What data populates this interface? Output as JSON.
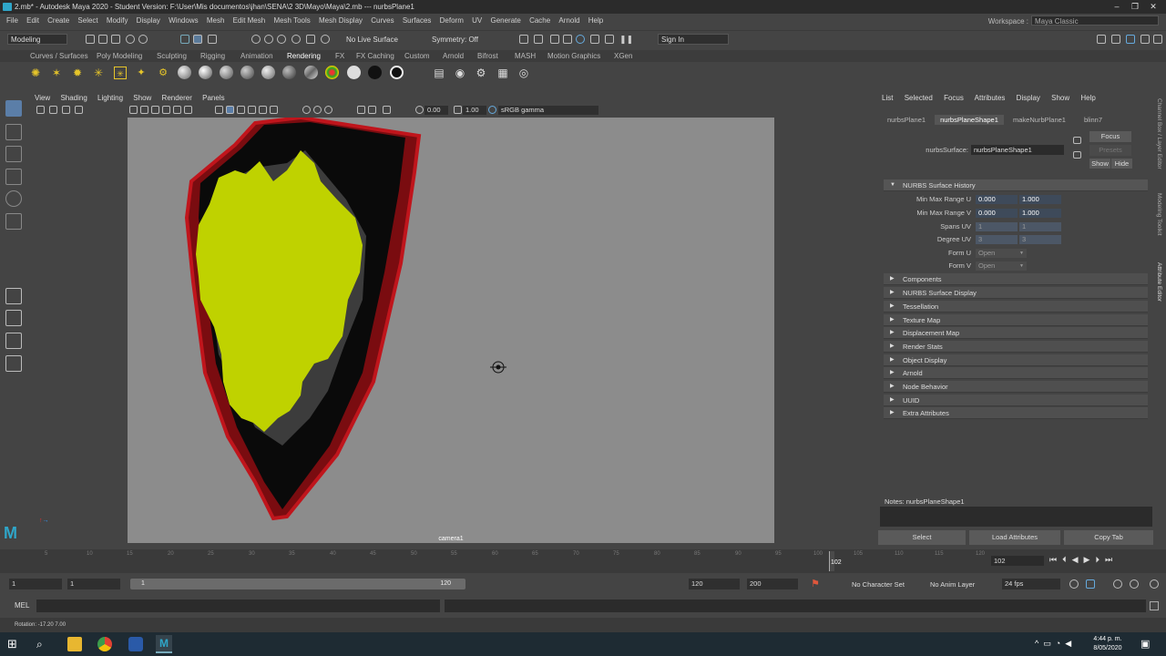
{
  "window": {
    "title": "2.mb* - Autodesk Maya 2020 - Student Version: F:\\User\\Mis documentos\\jhan\\SENA\\2 3D\\Mayo\\Maya\\2.mb  ---  nurbsPlane1"
  },
  "menubar": {
    "items": [
      "File",
      "Edit",
      "Create",
      "Select",
      "Modify",
      "Display",
      "Windows",
      "Mesh",
      "Edit Mesh",
      "Mesh Tools",
      "Mesh Display",
      "Curves",
      "Surfaces",
      "Deform",
      "UV",
      "Generate",
      "Cache",
      "Arnold",
      "Help"
    ],
    "workspace_label": "Workspace :",
    "workspace_value": "Maya Classic"
  },
  "statusline": {
    "mode": "Modeling",
    "live_surface": "No Live Surface",
    "symmetry": "Symmetry: Off",
    "sign_in": "Sign In"
  },
  "shelf": {
    "tabs": [
      "Curves / Surfaces",
      "Poly Modeling",
      "Sculpting",
      "Rigging",
      "Animation",
      "Rendering",
      "FX",
      "FX Caching",
      "Custom",
      "Arnold",
      "Bifrost",
      "MASH",
      "Motion Graphics",
      "XGen"
    ],
    "active_tab": "Rendering"
  },
  "viewport": {
    "menu": [
      "View",
      "Shading",
      "Lighting",
      "Show",
      "Renderer",
      "Panels"
    ],
    "exposure": "0.00",
    "gamma": "1.00",
    "color_space": "sRGB gamma",
    "camera_label": "camera1"
  },
  "attribute_editor": {
    "menu": [
      "List",
      "Selected",
      "Focus",
      "Attributes",
      "Display",
      "Show",
      "Help"
    ],
    "tabs": [
      "nurbsPlane1",
      "nurbsPlaneShape1",
      "makeNurbPlane1",
      "blinn7"
    ],
    "active_tab": "nurbsPlaneShape1",
    "node_label": "nurbsSurface:",
    "node_value": "nurbsPlaneShape1",
    "focus_button": "Focus",
    "presets_button": "Presets",
    "show_button": "Show",
    "hide_button": "Hide",
    "history_section": "NURBS Surface History",
    "fields": {
      "min_max_u_label": "Min Max Range U",
      "min_max_u": [
        "0.000",
        "1.000"
      ],
      "min_max_v_label": "Min Max Range V",
      "min_max_v": [
        "0.000",
        "1.000"
      ],
      "spans_label": "Spans UV",
      "spans": [
        "1",
        "1"
      ],
      "degree_label": "Degree UV",
      "degree": [
        "3",
        "3"
      ],
      "form_u_label": "Form U",
      "form_u": "Open",
      "form_v_label": "Form V",
      "form_v": "Open"
    },
    "sections": [
      "Components",
      "NURBS Surface Display",
      "Tessellation",
      "Texture Map",
      "Displacement Map",
      "Render Stats",
      "Object Display",
      "Arnold",
      "Node Behavior",
      "UUID",
      "Extra Attributes"
    ],
    "notes_label": "Notes:  nurbsPlaneShape1",
    "buttons": [
      "Select",
      "Load Attributes",
      "Copy Tab"
    ],
    "side_tabs": [
      "Channel Box / Layer Editor",
      "Modeling Toolkit",
      "Attribute Editor"
    ]
  },
  "timeline": {
    "ticks": [
      "5",
      "10",
      "15",
      "20",
      "25",
      "30",
      "35",
      "40",
      "45",
      "50",
      "55",
      "60",
      "65",
      "70",
      "75",
      "80",
      "85",
      "90",
      "95",
      "100",
      "105",
      "110",
      "115",
      "120"
    ],
    "current_frame": "102",
    "current_frame_field": "102"
  },
  "range": {
    "start": "1",
    "start2": "1",
    "range_start": "1",
    "range_end": "120",
    "end": "120",
    "end2": "200",
    "character_set": "No Character Set",
    "anim_layer": "No Anim Layer",
    "fps": "24 fps"
  },
  "cmdline": {
    "label": "MEL"
  },
  "helpline": {
    "text": "Rotation: -17.20    7.00"
  },
  "taskbar": {
    "time": "4:44 p. m.",
    "date": "8/05/2020"
  }
}
